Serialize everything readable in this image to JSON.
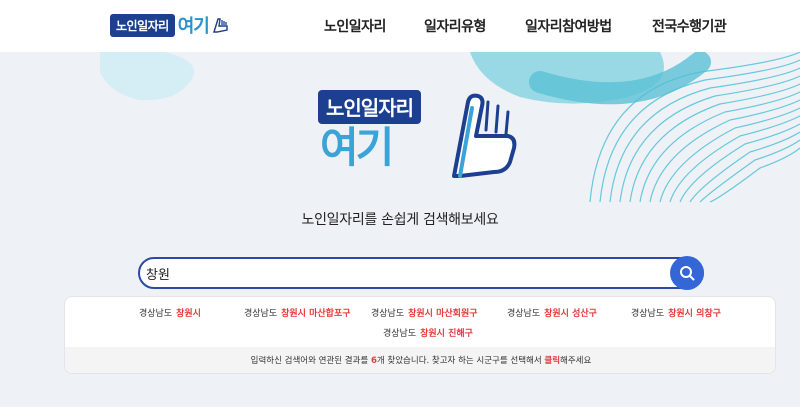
{
  "header": {
    "logo": {
      "label": "노인일자리",
      "suffix": "여기"
    },
    "nav": [
      "노인일자리",
      "일자리유형",
      "일자리참여방법",
      "전국수행기관"
    ]
  },
  "hero": {
    "logo_top": "노인일자리",
    "logo_bottom": "여기",
    "tagline": "노인일자리를 손쉽게 검색해보세요"
  },
  "search": {
    "value": "창원",
    "button_icon": "search-icon"
  },
  "results": {
    "items": [
      {
        "region": "경상남도",
        "city": "창원시"
      },
      {
        "region": "경상남도",
        "city": "창원시 마산합포구"
      },
      {
        "region": "경상남도",
        "city": "창원시 마산회원구"
      },
      {
        "region": "경상남도",
        "city": "창원시 성산구"
      },
      {
        "region": "경상남도",
        "city": "창원시 의창구"
      },
      {
        "region": "경상남도",
        "city": "창원시 진해구"
      }
    ],
    "footer": {
      "before": "입력하신 검색어와 연관된 결과를 ",
      "count": "6",
      "middle": "개 찾았습니다. 찾고자 하는 시군구를 선택해서 ",
      "click": "클릭",
      "after": "해주세요"
    }
  },
  "colors": {
    "brand_navy": "#1d3f8f",
    "brand_blue": "#3aa3d8",
    "search_border": "#2b4aa6",
    "search_button": "#3466d6",
    "highlight_red": "#e23b3b"
  }
}
